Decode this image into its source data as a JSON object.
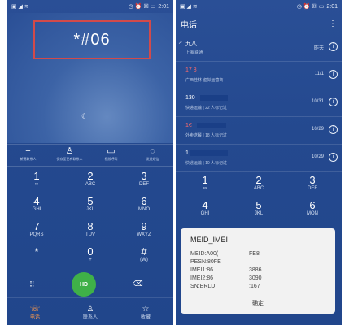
{
  "left": {
    "status": {
      "left_icons": "▣ ◢ ≋",
      "right_icons": "◷ ⏰ ☒ ▭",
      "time": "2:01"
    },
    "dialed": "*#06",
    "actions": [
      {
        "icon": "+",
        "label": "新建联系人"
      },
      {
        "icon": "♙",
        "label": "保存至已有联系人"
      },
      {
        "icon": "▭",
        "label": "视频呼叫"
      },
      {
        "icon": "◌",
        "label": "发送短信"
      }
    ],
    "keys": [
      {
        "n": "1",
        "l": "∞"
      },
      {
        "n": "2",
        "l": "ABC"
      },
      {
        "n": "3",
        "l": "DEF"
      },
      {
        "n": "4",
        "l": "GHI"
      },
      {
        "n": "5",
        "l": "JKL"
      },
      {
        "n": "6",
        "l": "MNO"
      },
      {
        "n": "7",
        "l": "PQRS"
      },
      {
        "n": "8",
        "l": "TUV"
      },
      {
        "n": "9",
        "l": "WXYZ"
      },
      {
        "n": "*",
        "l": ""
      },
      {
        "n": "0",
        "l": "+"
      },
      {
        "n": "#",
        "l": "(W)"
      }
    ],
    "call_label": "HD",
    "nav": [
      {
        "icon": "☏",
        "label": "电话"
      },
      {
        "icon": "♙",
        "label": "联系人"
      },
      {
        "icon": "☆",
        "label": "收藏"
      }
    ]
  },
  "right": {
    "status": {
      "left_icons": "▣ ◢ ≋",
      "right_icons": "◷ ⏰ ☒ ▭",
      "time": "2:01"
    },
    "title": "电话",
    "log": [
      {
        "name": "九八",
        "sub": "上海 联通",
        "date": "昨天",
        "missed": false
      },
      {
        "name": "17          8",
        "sub": "广西桂林 虚拟运营商",
        "date": "11/1",
        "missed": true
      },
      {
        "name": "130",
        "sub": "快递运输 | 22 人标记过",
        "date": "10/31",
        "missed": false
      },
      {
        "name": "1€",
        "sub": "外卖送餐 | 18 人标记过",
        "date": "10/29",
        "missed": true
      },
      {
        "name": "1",
        "sub": "快递运输 | 10 人标记过",
        "date": "10/29",
        "missed": false
      }
    ],
    "keys": [
      {
        "n": "1",
        "l": "∞"
      },
      {
        "n": "2",
        "l": "ABC"
      },
      {
        "n": "3",
        "l": "DEF"
      },
      {
        "n": "4",
        "l": "GHI"
      },
      {
        "n": "5",
        "l": "JKL"
      },
      {
        "n": "6",
        "l": "MON"
      }
    ],
    "dialog": {
      "title": "MEID_IMEI",
      "lines": [
        {
          "label": "MEID:A00(",
          "value": "FE8"
        },
        {
          "label": "PESN:80FE",
          "value": ""
        },
        {
          "label": "IMEI1:86",
          "value": "3886"
        },
        {
          "label": "IMEI2:86",
          "value": "3090"
        },
        {
          "label": "SN:ERLD",
          "value": ":167"
        }
      ],
      "ok": "确定"
    }
  }
}
